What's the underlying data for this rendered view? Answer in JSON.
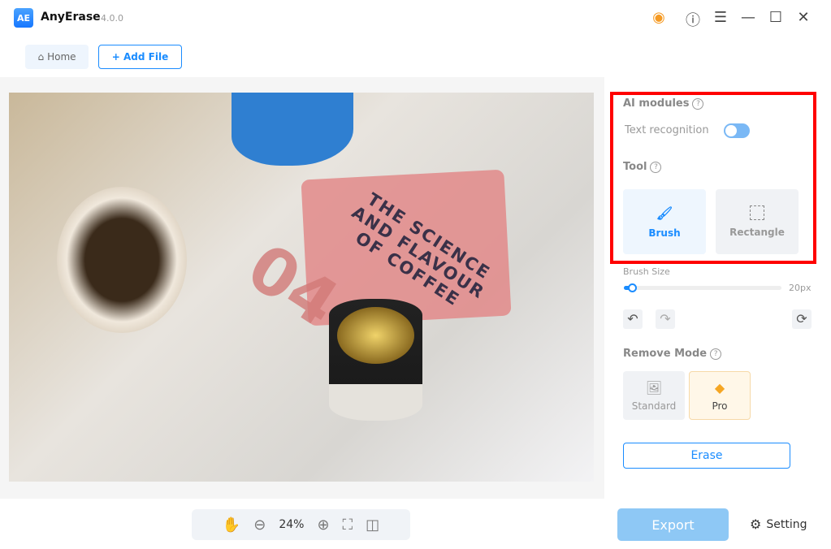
{
  "app": {
    "title": "AnyErase",
    "version": "4.0.0",
    "logo_text": "AE"
  },
  "window_icons": {
    "account": "user-icon",
    "help": "question-icon",
    "menu": "menu-icon",
    "minimize": "minimize-icon",
    "maximize": "maximize-icon",
    "close": "close-icon"
  },
  "nav": {
    "home": "Home",
    "add_file": "+ Add File"
  },
  "photo": {
    "text_lines": [
      "THE SCIENCE",
      "AND FLAVOUR",
      "OF COFFEE"
    ],
    "number": "04"
  },
  "panel": {
    "ai_modules": "AI modules",
    "text_recognition": "Text recognition",
    "text_recognition_on": true,
    "tool": "Tool",
    "tools": [
      {
        "label": "Brush",
        "selected": true
      },
      {
        "label": "Rectangle",
        "selected": false
      }
    ],
    "brush_size_label": "Brush Size",
    "brush_size_value": "20px",
    "brush_size_fraction": 0.05,
    "remove_mode": "Remove Mode",
    "modes": [
      {
        "label": "Standard",
        "selected": false
      },
      {
        "label": "Pro",
        "selected": true
      }
    ],
    "erase": "Erase"
  },
  "zoom": {
    "level": "24%"
  },
  "footer": {
    "export": "Export",
    "setting": "Setting"
  },
  "colors": {
    "accent": "#1a8cff",
    "highlight": "#ff0000"
  }
}
